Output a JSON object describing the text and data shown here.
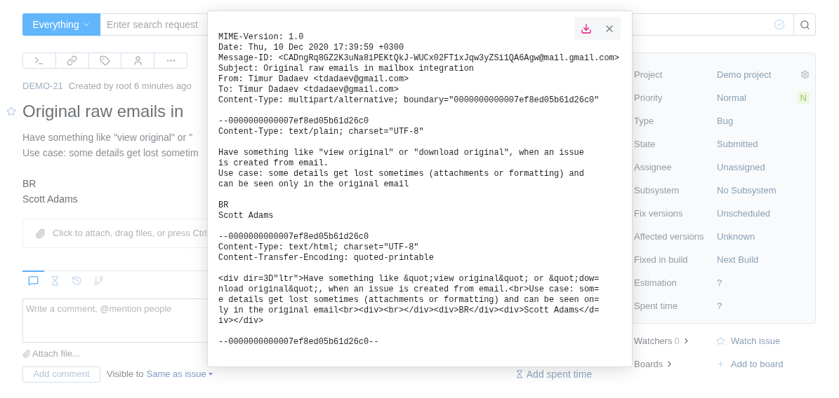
{
  "search": {
    "scope": "Everything",
    "placeholder": "Enter search request"
  },
  "issue": {
    "id": "DEMO-21",
    "created": "Created by root 6 minutes ago",
    "starred": false,
    "title": "Original raw emails in",
    "description": [
      "Have something like \"view original\" or \"",
      "Use case: some details get lost sometim"
    ],
    "signature": [
      "BR",
      "Scott Adams"
    ]
  },
  "attach_zone": "Click to attach, drag files, or press Ctrl",
  "activity_tabs": [
    {
      "kind": "comments",
      "selected": true
    },
    {
      "kind": "work",
      "selected": false
    },
    {
      "kind": "history",
      "selected": false
    },
    {
      "kind": "vcs",
      "selected": false
    }
  ],
  "comment": {
    "placeholder": "Write a comment, @mention people",
    "attach": "Attach file...",
    "submit": "Add comment",
    "visibility_label": "Visible to",
    "visibility": "Same as issue"
  },
  "spent_time_link": "Add spent time",
  "fields": [
    {
      "label": "Project",
      "value": "Demo project",
      "kind": "project"
    },
    {
      "label": "Priority",
      "value": "Normal",
      "kind": "priority",
      "badge": "N",
      "color": "#9bc46a"
    },
    {
      "label": "Type",
      "value": "Bug",
      "kind": "plain"
    },
    {
      "label": "State",
      "value": "Submitted",
      "kind": "plain"
    },
    {
      "label": "Assignee",
      "value": "Unassigned",
      "kind": "plain"
    },
    {
      "label": "Subsystem",
      "value": "No Subsystem",
      "kind": "plain"
    },
    {
      "label": "Fix versions",
      "value": "Unscheduled",
      "kind": "plain"
    },
    {
      "label": "Affected versions",
      "value": "Unknown",
      "kind": "plain"
    },
    {
      "label": "Fixed in build",
      "value": "Next Build",
      "kind": "plain"
    },
    {
      "label": "Estimation",
      "value": "?",
      "kind": "plain"
    },
    {
      "label": "Spent time",
      "value": "?",
      "kind": "plain"
    }
  ],
  "watchers": {
    "label": "Watchers",
    "count": "0",
    "action": "Watch issue",
    "watching": false
  },
  "boards": {
    "label": "Boards",
    "action": "Add to board"
  },
  "raw_email": {
    "text": "MIME-Version: 1.0\nDate: Thu, 10 Dec 2020 17:39:59 +0300\nMessage-ID: <CADngRq8GZ2K3uNa8iPEKtQkJ-WUCx02FT1xJqw3yZSi1QA6Agw@mail.gmail.com>\nSubject: Original raw emails in mailbox integration\nFrom: Timur Dadaev <tdadaev@gmail.com>\nTo: Timur Dadaev <tdadaev@gmail.com>\nContent-Type: multipart/alternative; boundary=\"0000000000007ef8ed05b61d26c0\"\n\n--0000000000007ef8ed05b61d26c0\nContent-Type: text/plain; charset=\"UTF-8\"\n\nHave something like \"view original\" or \"download original\", when an issue\nis created from email.\nUse case: some details get lost sometimes (attachments or formatting) and\ncan be seen only in the original email\n\nBR\nScott Adams\n\n--0000000000007ef8ed05b61d26c0\nContent-Type: text/html; charset=\"UTF-8\"\nContent-Transfer-Encoding: quoted-printable\n\n<div dir=3D\"ltr\">Have something like &quot;view original&quot; or &quot;dow=\nnload original&quot;, when an issue is created from email.<br>Use case: som=\ne details get lost sometimes (attachments or formatting) and can be seen on=\nly in the original email<br><div><br></div><div>BR</div><div>Scott Adams</d=\niv></div>\n\n--0000000000007ef8ed05b61d26c0--"
  }
}
